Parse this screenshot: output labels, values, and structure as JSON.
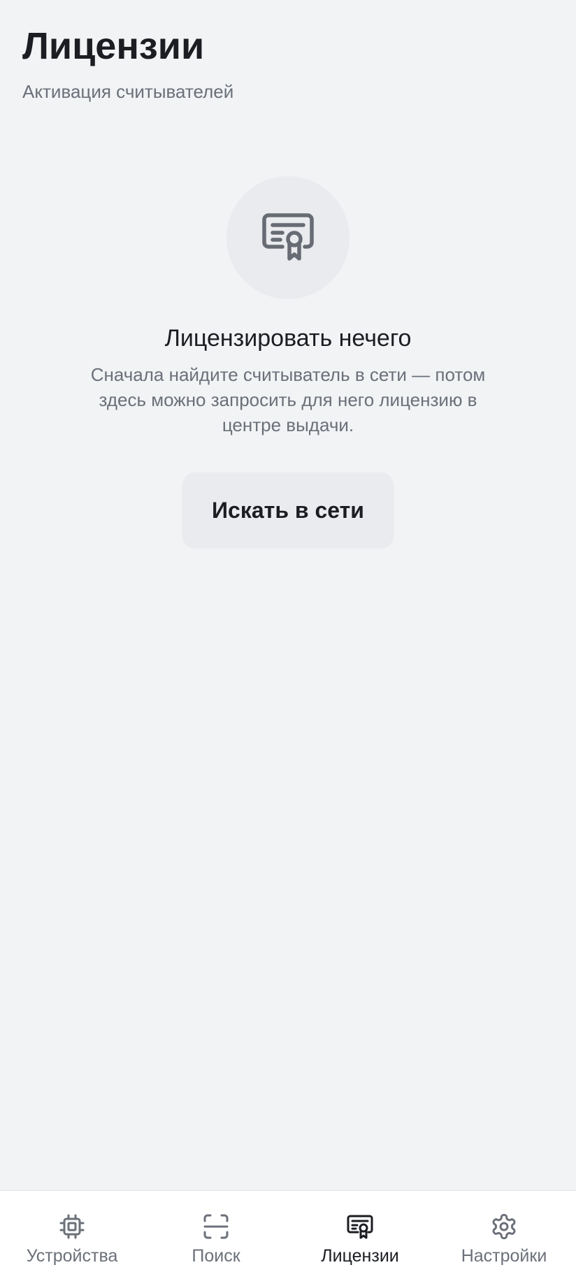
{
  "header": {
    "title": "Лицензии",
    "subtitle": "Активация считывателей"
  },
  "empty_state": {
    "icon": "certificate-icon",
    "title": "Лицензировать нечего",
    "text": "Сначала найдите считыватель в сети — потом здесь можно запросить для него лицензию в центре выдачи.",
    "button_label": "Искать в сети"
  },
  "bottom_nav": {
    "active": "licenses",
    "items": [
      {
        "id": "devices",
        "label": "Устройства",
        "icon": "chip-icon"
      },
      {
        "id": "search",
        "label": "Поиск",
        "icon": "scan-icon"
      },
      {
        "id": "licenses",
        "label": "Лицензии",
        "icon": "certificate-icon"
      },
      {
        "id": "settings",
        "label": "Настройки",
        "icon": "gear-icon"
      }
    ]
  },
  "colors": {
    "background": "#f1f3f5",
    "text_primary": "#1b1d22",
    "text_secondary": "#6b7079",
    "surface": "#e9ebee",
    "nav_background": "#ffffff"
  }
}
